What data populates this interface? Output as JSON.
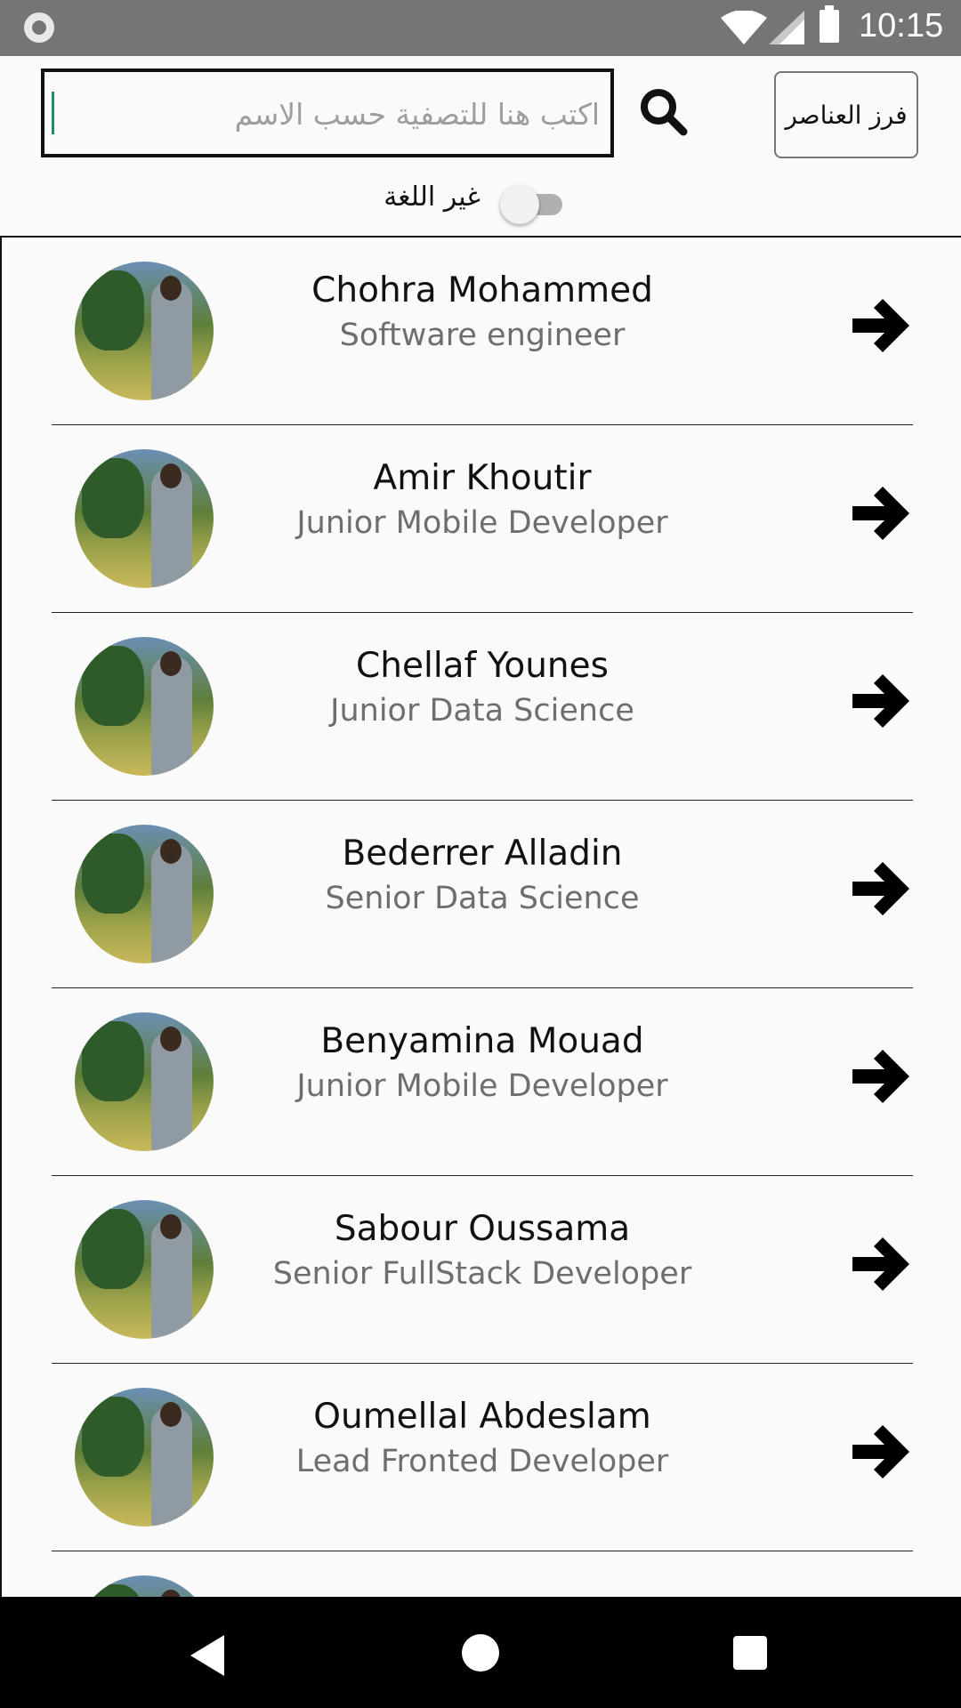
{
  "status_bar": {
    "time": "10:15"
  },
  "search": {
    "placeholder": "اكتب هنا للتصفية حسب الاسم"
  },
  "sort_button": {
    "label": "فرز العناصر"
  },
  "language_toggle": {
    "label": "غير اللغة",
    "on": false
  },
  "employees": [
    {
      "name": "Chohra Mohammed",
      "title": "Software engineer"
    },
    {
      "name": "Amir Khoutir",
      "title": "Junior Mobile Developer"
    },
    {
      "name": "Chellaf Younes",
      "title": "Junior Data Science"
    },
    {
      "name": "Bederrer Alladin",
      "title": "Senior Data Science"
    },
    {
      "name": "Benyamina Mouad",
      "title": "Junior Mobile Developer"
    },
    {
      "name": "Sabour Oussama",
      "title": "Senior FullStack Developer"
    },
    {
      "name": "Oumellal Abdeslam",
      "title": "Lead Fronted Developer"
    },
    {
      "name": "",
      "title": ""
    }
  ],
  "icons": {
    "search": "search-icon",
    "arrow": "arrow-right-icon",
    "nav_back": "back-icon",
    "nav_home": "home-icon",
    "nav_recent": "recent-apps-icon"
  }
}
